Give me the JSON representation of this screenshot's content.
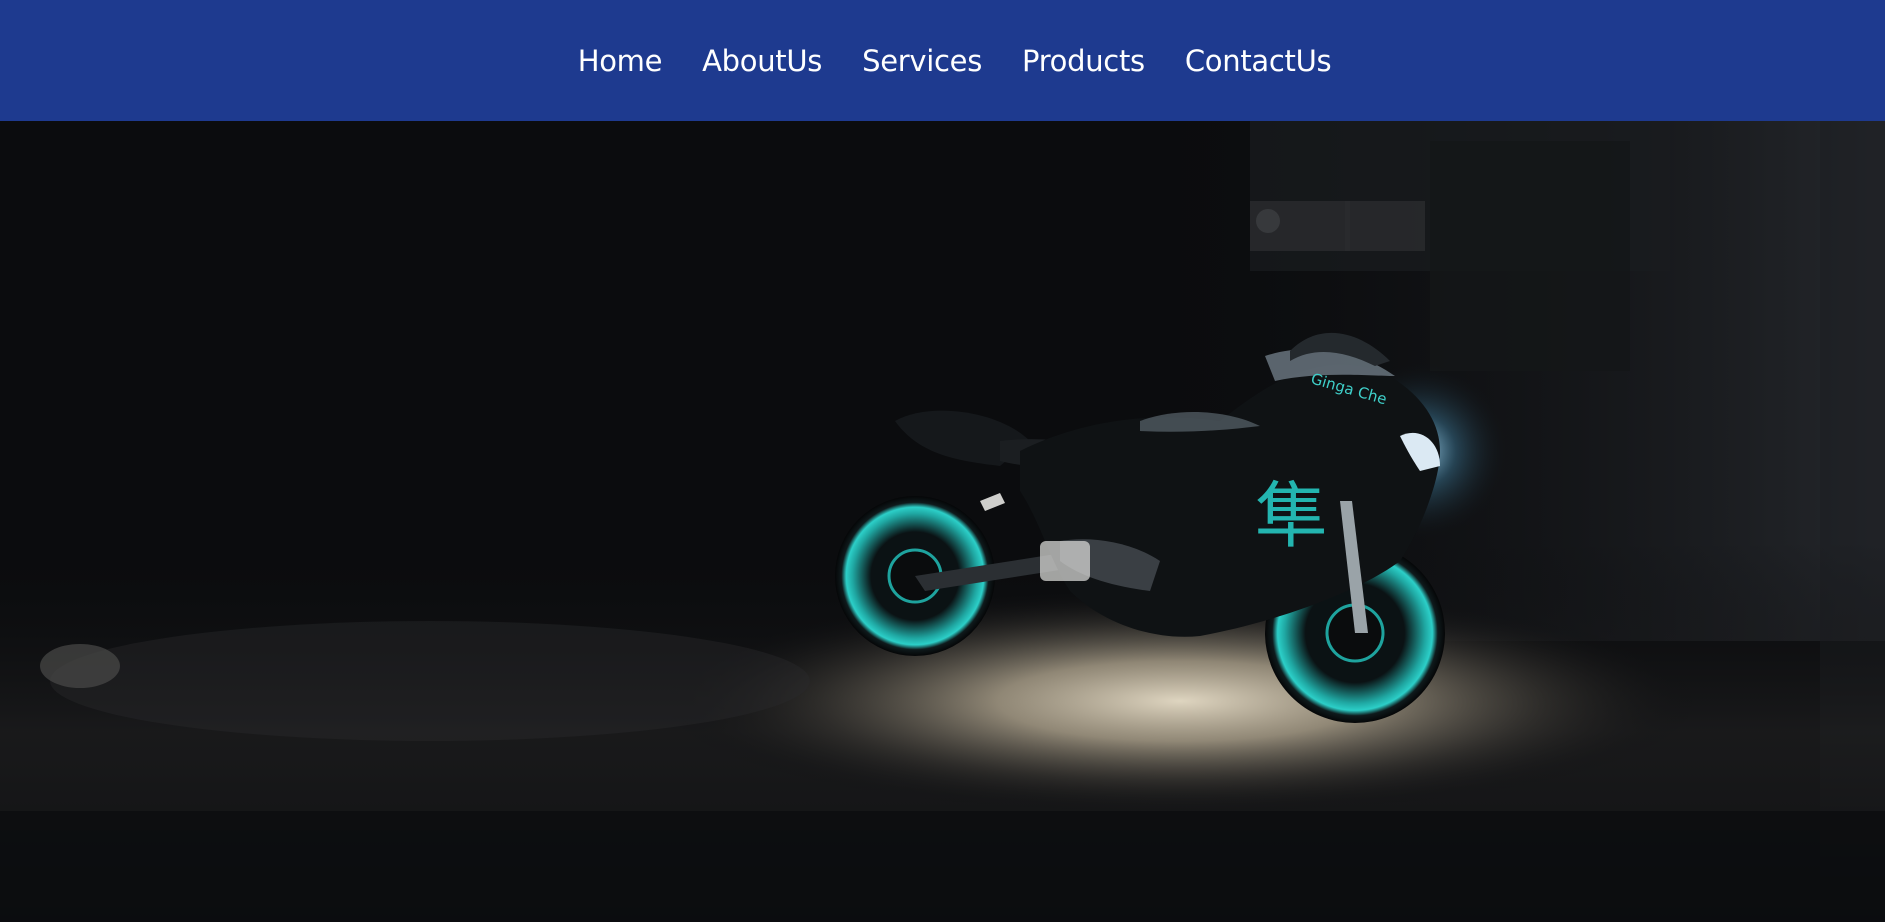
{
  "nav": {
    "items": [
      {
        "label": "Home"
      },
      {
        "label": "AboutUs"
      },
      {
        "label": "Services"
      },
      {
        "label": "Products"
      },
      {
        "label": "ContactUs"
      }
    ]
  },
  "colors": {
    "navbar_bg": "#1e3a8f",
    "nav_text": "#ffffff",
    "hero_bg": "#0b0c0e",
    "accent_teal": "#23b5b0"
  },
  "hero": {
    "image": "motorcycle-in-dark-garage-icon",
    "kanji_decal": "隼",
    "side_text": "Ginga Che"
  }
}
